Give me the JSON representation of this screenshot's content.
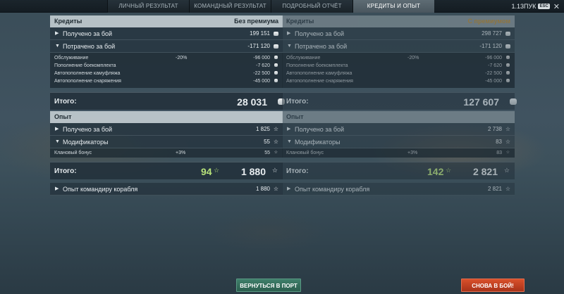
{
  "tabs": [
    {
      "label": "ЛИЧНЫЙ РЕЗУЛЬТАТ",
      "active": false
    },
    {
      "label": "КОМАНДНЫЙ РЕЗУЛЬТАТ",
      "active": false
    },
    {
      "label": "ПОДРОБНЫЙ ОТЧЁТ",
      "active": false
    },
    {
      "label": "КРЕДИТЫ И ОПЫТ",
      "active": true
    }
  ],
  "version": "1.13ПУК",
  "esc_label": "ESC",
  "close_glyph": "✕",
  "left": {
    "credits_title": "Кредиты",
    "credits_mode": "Без премиума",
    "earned_label": "Получено за бой",
    "earned_value": "199 151",
    "spent_label": "Потрачено за бой",
    "spent_value": "-171 120",
    "sub": [
      {
        "label": "Обслуживание",
        "pct": "-20%",
        "value": "-96 000"
      },
      {
        "label": "Пополнение боекомплекта",
        "pct": "",
        "value": "-7 620"
      },
      {
        "label": "Автопополнение камуфляжа",
        "pct": "",
        "value": "-22 500"
      },
      {
        "label": "Автопополнение снаряжения",
        "pct": "",
        "value": "-45 000"
      }
    ],
    "credits_total_label": "Итого:",
    "credits_total_value": "28 031",
    "xp_title": "Опыт",
    "xp_earned_label": "Получено за бой",
    "xp_earned_value": "1 825",
    "modifiers_label": "Модификаторы",
    "modifiers_value": "55",
    "clan_label": "Клановый бонус",
    "clan_pct": "+3%",
    "clan_value": "55",
    "xp_total_label": "Итого:",
    "xp_total_free": "94",
    "xp_total_value": "1 880",
    "commander_label": "Опыт командиру корабля",
    "commander_value": "1 880"
  },
  "right": {
    "credits_title": "Кредиты",
    "credits_mode": "С премиумом",
    "earned_label": "Получено за бой",
    "earned_value": "298 727",
    "spent_label": "Потрачено за бой",
    "spent_value": "-171 120",
    "sub": [
      {
        "label": "Обслуживание",
        "pct": "-20%",
        "value": "-96 000"
      },
      {
        "label": "Пополнение боекомплекта",
        "pct": "",
        "value": "-7 620"
      },
      {
        "label": "Автопополнение камуфляжа",
        "pct": "",
        "value": "-22 500"
      },
      {
        "label": "Автопополнение снаряжения",
        "pct": "",
        "value": "-45 000"
      }
    ],
    "credits_total_label": "Итого:",
    "credits_total_value": "127 607",
    "xp_title": "Опыт",
    "xp_earned_label": "Получено за бой",
    "xp_earned_value": "2 738",
    "modifiers_label": "Модификаторы",
    "modifiers_value": "83",
    "clan_label": "Клановый бонус",
    "clan_pct": "+3%",
    "clan_value": "83",
    "xp_total_label": "Итого:",
    "xp_total_free": "142",
    "xp_total_value": "2 821",
    "commander_label": "Опыт командиру корабля",
    "commander_value": "2 821"
  },
  "icons": {
    "credits": "credits-icon",
    "xp": "xp-star-icon",
    "expand": "triangle-right-icon",
    "collapse": "triangle-down-icon"
  },
  "buttons": {
    "port": "ВЕРНУТЬСЯ В ПОРТ",
    "battle": "СНОВА В БОЙ!"
  },
  "colors": {
    "premium_accent": "#c38d2f",
    "free_xp": "#b7e27a",
    "port_button": "#2f6b5a",
    "battle_button": "#c9401f"
  }
}
